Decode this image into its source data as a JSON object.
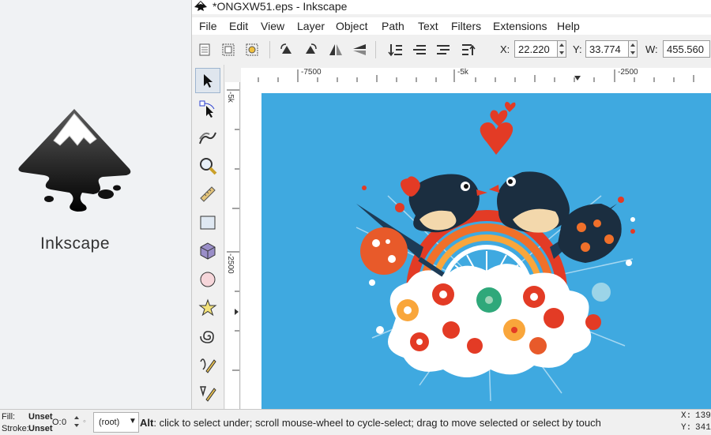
{
  "app": {
    "name": "Inkscape"
  },
  "window": {
    "title": "*ONGXW51.eps - Inkscape"
  },
  "menu": [
    "File",
    "Edit",
    "View",
    "Layer",
    "Object",
    "Path",
    "Text",
    "Filters",
    "Extensions",
    "Help"
  ],
  "toolbar": {
    "x_label": "X:",
    "x_value": "22.220",
    "y_label": "Y:",
    "y_value": "33.774",
    "w_label": "W:",
    "w_value": "455.560"
  },
  "rulers": {
    "h_ticks": [
      "-7500",
      "-5k",
      "-2500"
    ],
    "v_ticks": [
      "-5k",
      "-2500"
    ]
  },
  "tools": [
    "selector-tool",
    "node-tool",
    "tweak-tool",
    "zoom-tool",
    "measure-tool",
    "rectangle-tool",
    "3d-box-tool",
    "ellipse-tool",
    "star-tool",
    "spiral-tool",
    "pencil-tool",
    "pen-tool"
  ],
  "status": {
    "fill_label": "Fill:",
    "fill_value": "Unset",
    "stroke_label": "Stroke:",
    "stroke_value": "Unset",
    "opacity_label": "O:",
    "opacity_value": "0",
    "layer": "(root)",
    "hint_key": "Alt",
    "hint_text": ": click to select under; scroll mouse-wheel to cycle-select; drag to move selected or select by touch",
    "cursor_x_label": "X:",
    "cursor_x": "139",
    "cursor_y_label": "Y:",
    "cursor_y": "341"
  },
  "colors": {
    "canvas_background": "#3fa9e0",
    "accent": "#e53935"
  }
}
